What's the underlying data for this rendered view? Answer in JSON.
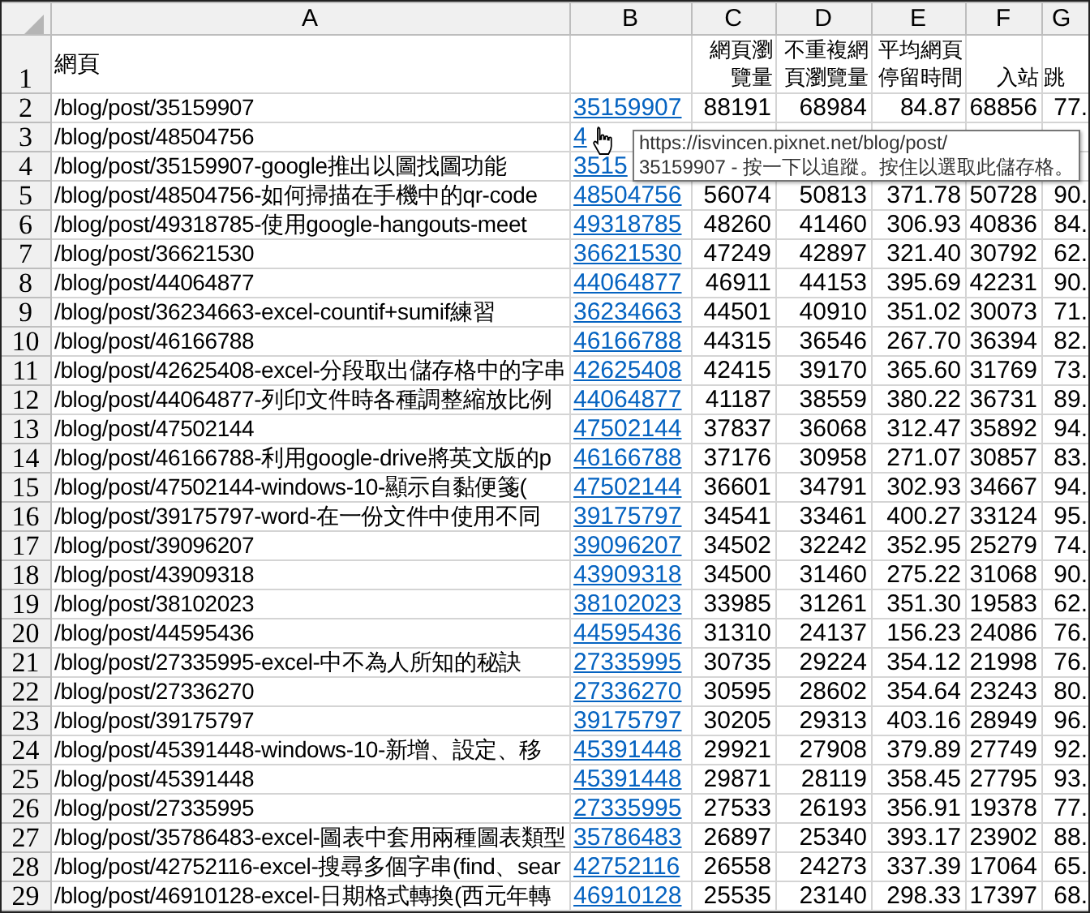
{
  "columns": [
    "A",
    "B",
    "C",
    "D",
    "E",
    "F",
    "G"
  ],
  "header_row": {
    "number": "1",
    "cells": [
      "網頁",
      "",
      "網頁瀏覽量",
      "不重複網頁瀏覽量",
      "平均網頁停留時間",
      "入站",
      "跳"
    ]
  },
  "rows": [
    {
      "number": "2",
      "page": "/blog/post/35159907",
      "link": "35159907",
      "cells": [
        "88191",
        "68984",
        "84.87",
        "68856",
        "77."
      ]
    },
    {
      "number": "3",
      "page": "/blog/post/48504756",
      "link": "4"
    },
    {
      "number": "4",
      "page": "/blog/post/35159907-google推出以圖找圖功能",
      "link": "3515"
    },
    {
      "number": "5",
      "page": "/blog/post/48504756-如何掃描在手機中的qr-code",
      "link": "48504756",
      "cells": [
        "56074",
        "50813",
        "371.78",
        "50728",
        "90."
      ]
    },
    {
      "number": "6",
      "page": "/blog/post/49318785-使用google-hangouts-meet",
      "link": "49318785",
      "cells": [
        "48260",
        "41460",
        "306.93",
        "40836",
        "84."
      ]
    },
    {
      "number": "7",
      "page": "/blog/post/36621530",
      "link": "36621530",
      "cells": [
        "47249",
        "42897",
        "321.40",
        "30792",
        "62."
      ]
    },
    {
      "number": "8",
      "page": "/blog/post/44064877",
      "link": "44064877",
      "cells": [
        "46911",
        "44153",
        "395.69",
        "42231",
        "90."
      ]
    },
    {
      "number": "9",
      "page": "/blog/post/36234663-excel-countif+sumif練習",
      "link": "36234663",
      "cells": [
        "44501",
        "40910",
        "351.02",
        "30073",
        "71."
      ]
    },
    {
      "number": "10",
      "page": "/blog/post/46166788",
      "link": "46166788",
      "cells": [
        "44315",
        "36546",
        "267.70",
        "36394",
        "82."
      ]
    },
    {
      "number": "11",
      "page": "/blog/post/42625408-excel-分段取出儲存格中的字串",
      "link": "42625408",
      "cells": [
        "42415",
        "39170",
        "365.60",
        "31769",
        "73."
      ]
    },
    {
      "number": "12",
      "page": "/blog/post/44064877-列印文件時各種調整縮放比例",
      "link": "44064877",
      "cells": [
        "41187",
        "38559",
        "380.22",
        "36731",
        "89."
      ]
    },
    {
      "number": "13",
      "page": "/blog/post/47502144",
      "link": "47502144",
      "cells": [
        "37837",
        "36068",
        "312.47",
        "35892",
        "94."
      ]
    },
    {
      "number": "14",
      "page": "/blog/post/46166788-利用google-drive將英文版的p",
      "link": "46166788",
      "cells": [
        "37176",
        "30958",
        "271.07",
        "30857",
        "83."
      ]
    },
    {
      "number": "15",
      "page": "/blog/post/47502144-windows-10-顯示自黏便箋(",
      "link": "47502144",
      "cells": [
        "36601",
        "34791",
        "302.93",
        "34667",
        "94."
      ]
    },
    {
      "number": "16",
      "page": "/blog/post/39175797-word-在一份文件中使用不同",
      "link": "39175797",
      "cells": [
        "34541",
        "33461",
        "400.27",
        "33124",
        "95."
      ]
    },
    {
      "number": "17",
      "page": "/blog/post/39096207",
      "link": "39096207",
      "cells": [
        "34502",
        "32242",
        "352.95",
        "25279",
        "74."
      ]
    },
    {
      "number": "18",
      "page": "/blog/post/43909318",
      "link": "43909318",
      "cells": [
        "34500",
        "31460",
        "275.22",
        "31068",
        "90."
      ]
    },
    {
      "number": "19",
      "page": "/blog/post/38102023",
      "link": "38102023",
      "cells": [
        "33985",
        "31261",
        "351.30",
        "19583",
        "62."
      ]
    },
    {
      "number": "20",
      "page": "/blog/post/44595436",
      "link": "44595436",
      "cells": [
        "31310",
        "24137",
        "156.23",
        "24086",
        "76."
      ]
    },
    {
      "number": "21",
      "page": "/blog/post/27335995-excel-中不為人所知的秘訣",
      "link": "27335995",
      "cells": [
        "30735",
        "29224",
        "354.12",
        "21998",
        "76."
      ]
    },
    {
      "number": "22",
      "page": "/blog/post/27336270",
      "link": "27336270",
      "cells": [
        "30595",
        "28602",
        "354.64",
        "23243",
        "80."
      ]
    },
    {
      "number": "23",
      "page": "/blog/post/39175797",
      "link": "39175797",
      "cells": [
        "30205",
        "29313",
        "403.16",
        "28949",
        "96."
      ]
    },
    {
      "number": "24",
      "page": "/blog/post/45391448-windows-10-新增、設定、移",
      "link": "45391448",
      "cells": [
        "29921",
        "27908",
        "379.89",
        "27749",
        "92."
      ]
    },
    {
      "number": "25",
      "page": "/blog/post/45391448",
      "link": "45391448",
      "cells": [
        "29871",
        "28119",
        "358.45",
        "27795",
        "93."
      ]
    },
    {
      "number": "26",
      "page": "/blog/post/27335995",
      "link": "27335995",
      "cells": [
        "27533",
        "26193",
        "356.91",
        "19378",
        "77."
      ]
    },
    {
      "number": "27",
      "page": "/blog/post/35786483-excel-圖表中套用兩種圖表類型",
      "link": "35786483",
      "cells": [
        "26897",
        "25340",
        "393.17",
        "23902",
        "88."
      ]
    },
    {
      "number": "28",
      "page": "/blog/post/42752116-excel-搜尋多個字串(find、sear",
      "link": "42752116",
      "cells": [
        "26558",
        "24273",
        "337.39",
        "17064",
        "65."
      ]
    },
    {
      "number": "29",
      "page": "/blog/post/46910128-excel-日期格式轉換(西元年轉",
      "link": "46910128",
      "cells": [
        "25535",
        "23140",
        "298.33",
        "17397",
        "68."
      ]
    }
  ],
  "tooltip": {
    "lines": [
      "https://isvincen.pixnet.net/blog/post/",
      "35159907 - 按一下以追蹤。按住以選取此儲存格。"
    ]
  }
}
